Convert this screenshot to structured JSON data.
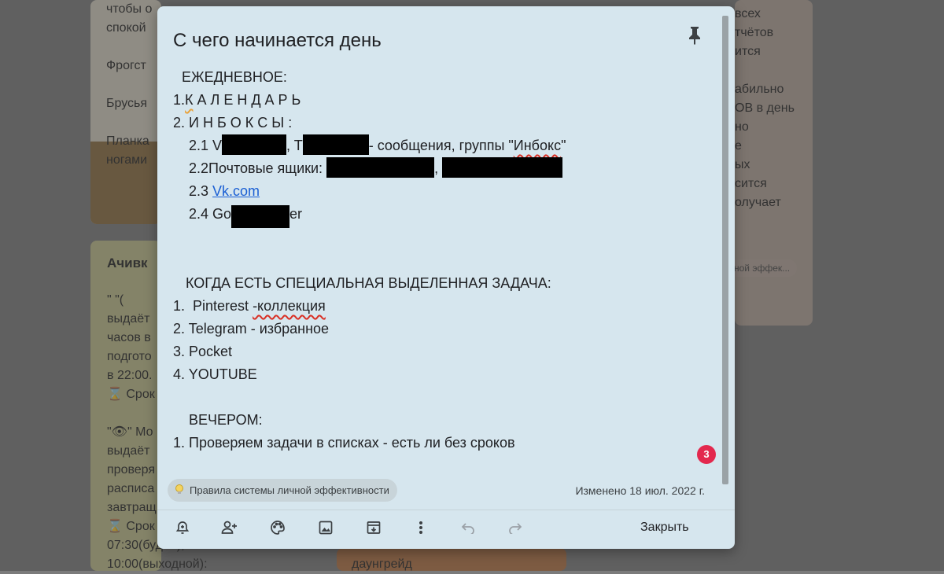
{
  "background": {
    "card_left_top": "чтобы о\nспокой\n\nФрогст\n\nБрусья\n\nПланка\nногами",
    "card_right_top": "всех\nтчётов\nится\n\nабильно\nОВ в день\nно\nе\nых\nсится\nолучает",
    "card_right_top_chip": "ной эффек...",
    "card_left_bottom_title": "Ачивк",
    "card_left_bottom": "\" \"(\nвыдаёт\nчасов в\nподгото\nв 22:00.\n⌛ Срок\n\n\"👁\" Мо\nвыдаёт\nпроверя\nрасписа\nзавтращ\n⌛ Срок\n07:30(будни),\n10:00(выходной):",
    "card_middle_bottom": "даунгрейд"
  },
  "note": {
    "title": "С чего начинается день",
    "heading_daily": "ЕЖЕДНЕВНОЕ:",
    "item1_num": "1.",
    "item1_first": "К",
    "item1_rest": " А Л Е Н Д А Р Ь",
    "item2": "2. И Н Б О К С Ы :",
    "item21_a": "2.1 V",
    "item21_b": ", T",
    "item21_c": "- сообщения, группы \"",
    "item21_d": "Инбокс",
    "item21_e": "\"",
    "item22_a": "2.2Почтовые ящики: ",
    "item22_b": ", ",
    "item23_a": "2.3 ",
    "item23_link": "Vk.com",
    "item24_a": "2.4 Go",
    "item24_b": "er",
    "heading_special": "КОГДА ЕСТЬ СПЕЦИАЛЬНАЯ ВЫДЕЛЕННАЯ ЗАДАЧА:",
    "special_1a": "1.  Pinterest ",
    "special_1b": "-коллекция",
    "special_2": "2. Telegram - избранное",
    "special_3": "3. Pocket",
    "special_4": "4. YOUTUBE",
    "heading_evening": "ВЕЧЕРОМ:",
    "evening_1": "1. Проверяем задачи в списках - есть ли без сроков",
    "badge_count": "3",
    "label": "Правила системы личной эффективности",
    "edited": "Изменено 18 июл. 2022 г.",
    "close_label": "Закрыть"
  },
  "toolbar_icons": [
    "bell-plus-icon",
    "person-add-icon",
    "palette-icon",
    "image-icon",
    "archive-icon",
    "more-vert-icon",
    "undo-icon",
    "redo-icon"
  ],
  "colors": {
    "modal_bg": "#d6e6ee",
    "link": "#1a5fd4",
    "badge": "#e3284d",
    "spellcheck": "#d93025"
  }
}
